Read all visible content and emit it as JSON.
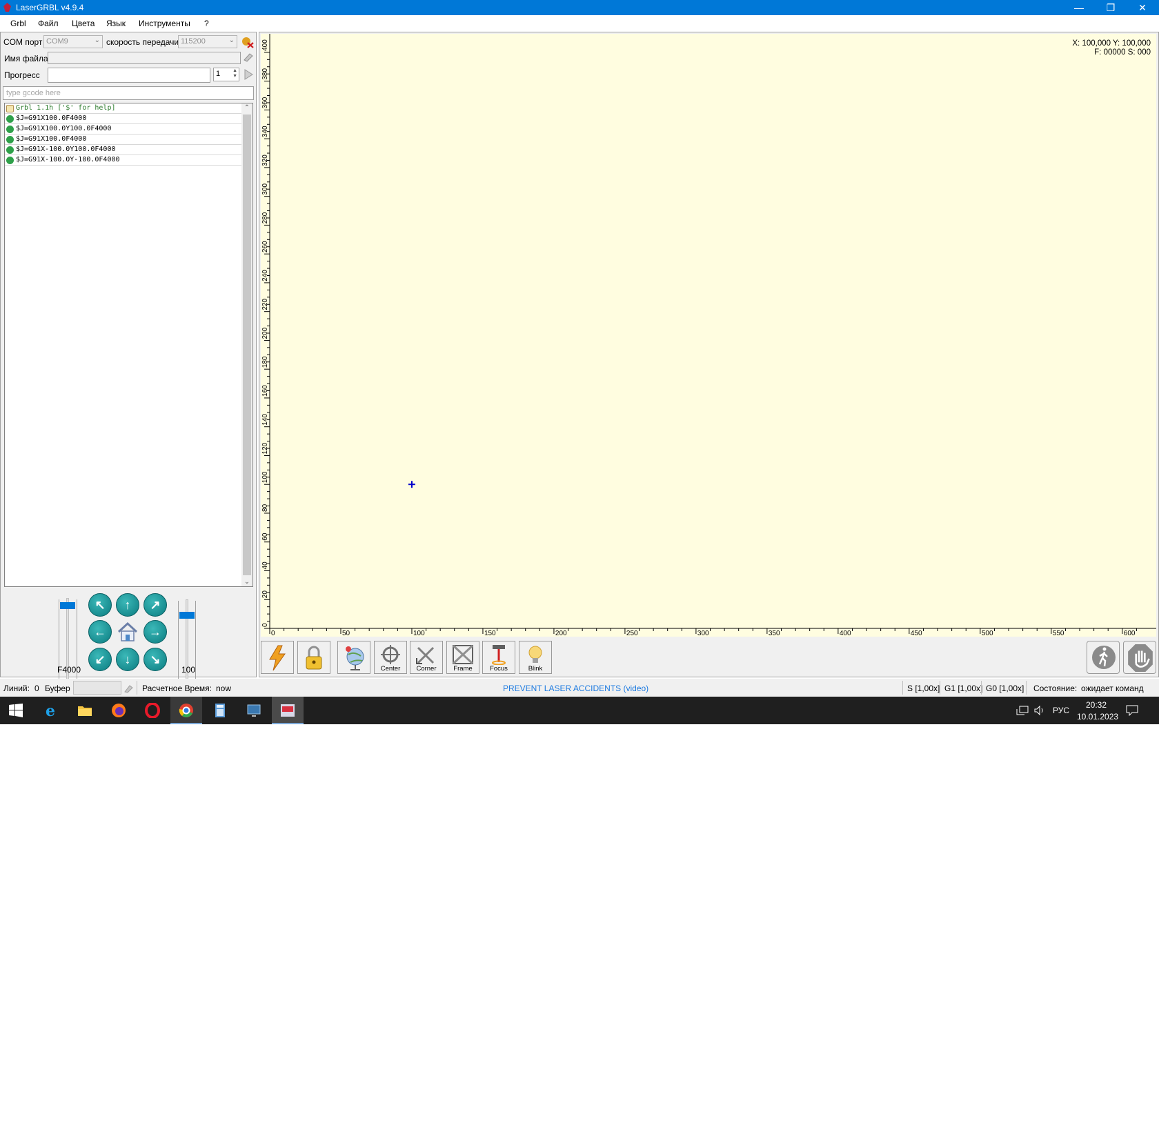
{
  "window": {
    "title": "LaserGRBL v4.9.4",
    "minimize": "—",
    "restore": "❐",
    "close": "✕"
  },
  "menu": [
    "Grbl",
    "Файл",
    "Цвета",
    "Язык",
    "Инструменты",
    "?"
  ],
  "connection": {
    "com_label": "COM порт",
    "com_value": "COM9",
    "baud_label": "скорость передачи",
    "baud_value": "115200",
    "file_label": "Имя файла",
    "progress_label": "Прогресс",
    "passes_value": "1",
    "gcode_placeholder": "type gcode here"
  },
  "console": [
    {
      "text": "Grbl 1.1h ['$' for help]",
      "status": "info"
    },
    {
      "text": "$J=G91X100.0F4000",
      "status": "ok"
    },
    {
      "text": "$J=G91X100.0Y100.0F4000",
      "status": "ok"
    },
    {
      "text": "$J=G91X100.0F4000",
      "status": "ok"
    },
    {
      "text": "$J=G91X-100.0Y100.0F4000",
      "status": "ok"
    },
    {
      "text": "$J=G91X-100.0Y-100.0F4000",
      "status": "ok"
    }
  ],
  "jog": {
    "speed_label": "F4000",
    "step_label": "100",
    "speed_level": 0.95,
    "step_level": 0.85
  },
  "canvas": {
    "coords_line1": "X: 100,000 Y: 100,000",
    "coords_line2": "F: 00000 S: 000",
    "y_ticks": [
      "0",
      "20",
      "40",
      "60",
      "80",
      "100",
      "120",
      "140",
      "160",
      "180",
      "200",
      "220",
      "240",
      "260",
      "280",
      "300",
      "320",
      "340",
      "360",
      "380",
      "400"
    ],
    "x_ticks": [
      "0",
      "50",
      "100",
      "150",
      "200",
      "250",
      "300",
      "350",
      "400",
      "450",
      "500",
      "550",
      "600"
    ],
    "cursor": {
      "x": 100,
      "y": 100
    }
  },
  "toolbar": {
    "center": "Center",
    "corner": "Corner",
    "frame": "Frame",
    "focus": "Focus",
    "blink": "Blink"
  },
  "status": {
    "lines_label": "Линий:",
    "lines_value": "0",
    "buffer_label": "Буфер",
    "time_label": "Расчетное Время:",
    "time_value": "now",
    "link": "PREVENT LASER ACCIDENTS (video)",
    "s_override": "S [1,00x]",
    "g1_override": "G1 [1,00x]",
    "g0_override": "G0 [1,00x]",
    "state_label": "Состояние:",
    "state_value": "ожидает команд"
  },
  "taskbar": {
    "lang": "РУС",
    "time": "20:32",
    "date": "10.01.2023"
  },
  "colors": {
    "titlebar": "#0078d7",
    "canvas_bg": "#fffde0",
    "link": "#1e7be0",
    "cursor": "#0000cc"
  }
}
